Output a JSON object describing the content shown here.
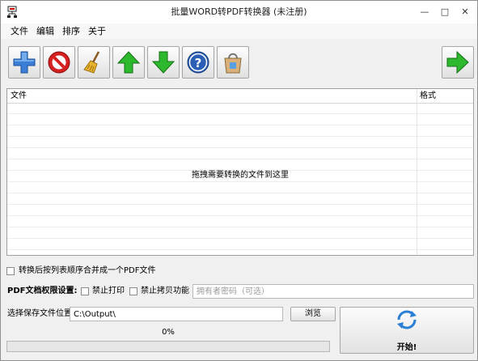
{
  "window": {
    "title": "批量WORD转PDF转换器 (未注册)",
    "controls": {
      "minimize": "—",
      "maximize": "□",
      "close": "✕"
    }
  },
  "menu": [
    "文件",
    "编辑",
    "排序",
    "关于"
  ],
  "toolbar": [
    {
      "id": "add",
      "icon": "plus-icon"
    },
    {
      "id": "remove",
      "icon": "no-entry-icon"
    },
    {
      "id": "clear",
      "icon": "broom-icon"
    },
    {
      "id": "move_up",
      "icon": "arrow-up-icon"
    },
    {
      "id": "move_down",
      "icon": "arrow-down-icon"
    },
    {
      "id": "help",
      "icon": "help-icon"
    },
    {
      "id": "buy",
      "icon": "shopping-bag-icon"
    },
    {
      "id": "next",
      "icon": "arrow-right-icon"
    }
  ],
  "file_list": {
    "columns": [
      "文件",
      "格式"
    ],
    "drop_hint": "拖拽需要转换的文件到这里"
  },
  "merge_option": {
    "label": "转换后按列表顺序合并成一个PDF文件",
    "checked": false
  },
  "permissions": {
    "label": "PDF文档权限设置:",
    "disable_print": {
      "label": "禁止打印",
      "checked": false
    },
    "disable_copy": {
      "label": "禁止拷贝功能",
      "checked": false
    },
    "owner_password_placeholder": "拥有者密码（可选）",
    "owner_password_value": ""
  },
  "output": {
    "label": "选择保存文件位置",
    "path": "C:\\Output\\",
    "browse_label": "浏览"
  },
  "progress": {
    "text": "0%",
    "value": 0
  },
  "start_button": {
    "label": "开始!"
  },
  "colors": {
    "toolbar_green": "#2eb82e",
    "stop_red": "#d42020",
    "help_blue": "#2b5fb5",
    "progress_green": "#06b025"
  }
}
